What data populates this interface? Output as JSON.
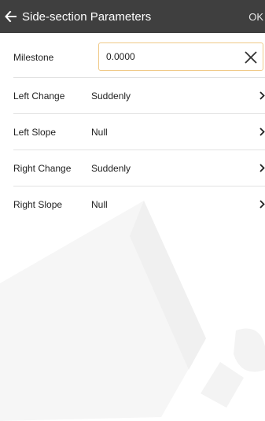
{
  "header": {
    "title": "Side-section Parameters",
    "ok_label": "OK",
    "back_icon": "arrow-left-icon"
  },
  "form": {
    "milestone": {
      "label": "Milestone",
      "value": "0.0000",
      "clear_icon": "close-icon"
    },
    "rows": [
      {
        "label": "Left Change",
        "value": "Suddenly",
        "icon": "chevron-right-icon"
      },
      {
        "label": "Left Slope",
        "value": "Null",
        "icon": "chevron-right-icon"
      },
      {
        "label": "Right Change",
        "value": "Suddenly",
        "icon": "chevron-right-icon"
      },
      {
        "label": "Right Slope",
        "value": "Null",
        "icon": "chevron-right-icon"
      }
    ]
  },
  "colors": {
    "titlebar": "#3f3f3f",
    "input_border": "#f0c987",
    "divider": "#e2e2e2",
    "watermark": "#efefef"
  }
}
